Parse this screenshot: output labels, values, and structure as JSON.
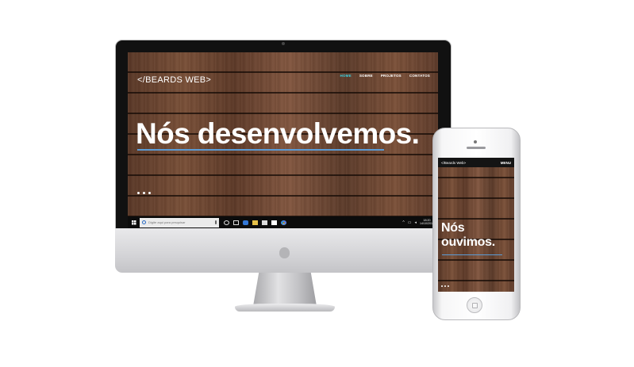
{
  "desktop": {
    "logo": "</BEARDS WEB>",
    "nav": [
      "HOME",
      "SOBRE",
      "PROJETOS",
      "CONTATOS"
    ],
    "active_nav": "HOME",
    "hero_title": "Nós desenvolvemos.",
    "slider_dots": 3,
    "taskbar": {
      "search_placeholder": "Digite aqui para pesquisar",
      "time": "18:20",
      "date": "14/10/2017",
      "tray_chevron": "^",
      "volume_icon": "volume-icon"
    }
  },
  "mobile": {
    "logo": "</Beards Web>",
    "menu_label": "MENU",
    "hero_title": "Nós ouvimos.",
    "slider_dots": 3
  },
  "colors": {
    "accent_nav": "#3ad0e0",
    "underline": "#5b9bd5",
    "wood": "#6b4532",
    "taskbar": "#0c0c0c"
  }
}
